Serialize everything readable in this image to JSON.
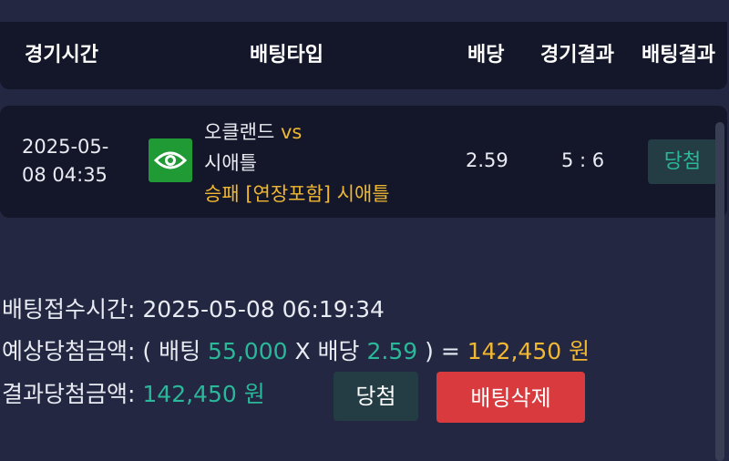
{
  "header": {
    "col_time": "경기시간",
    "col_bet_type": "배팅타입",
    "col_odds": "배당",
    "col_game_result": "경기결과",
    "col_bet_result": "배팅결과"
  },
  "bet": {
    "time_line1": "2025-05-",
    "time_line2": "08 04:35",
    "sport_icon": "eye-icon",
    "home_team": "오클랜드",
    "vs_label": "vs",
    "away_team": "시애틀",
    "pick": "승패 [연장포함] 시애틀",
    "odds": "2.59",
    "score": "5 : 6",
    "result": "당첨"
  },
  "summary": {
    "received_label": "배팅접수시간:",
    "received_value": "2025-05-08 06:19:34",
    "expected_label": "예상당첨금액:",
    "open_paren": "( 배팅",
    "bet_amount": "55,000",
    "times": "X 배당",
    "odds": "2.59",
    "close_eq": ") =",
    "expected_amount": "142,450 원",
    "result_label": "결과당첨금액:",
    "result_amount": "142,450 원",
    "result_badge": "당첨",
    "delete_button": "배팅삭제"
  },
  "colors": {
    "background": "#232741",
    "panel": "#141729",
    "accent_gold": "#f0b732",
    "accent_green": "#2ab89a",
    "danger": "#d83a3d",
    "icon_green": "#1f9a35"
  }
}
